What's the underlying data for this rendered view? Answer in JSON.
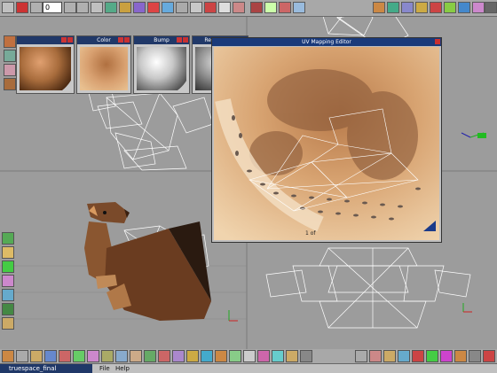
{
  "top_toolbar": {
    "frame_value": "0"
  },
  "material_panels": [
    {
      "title": "",
      "color": "#a86c3c"
    },
    {
      "title": "Color",
      "color": "#d8a070"
    },
    {
      "title": "Bump",
      "color": "#d8d8d8"
    },
    {
      "title": "Reflectance",
      "color": "#909090"
    }
  ],
  "uv_editor": {
    "title": "UV Mapping Editor",
    "status": "1 of"
  },
  "statusbar": {
    "filename": "truespace_final",
    "menu": [
      "File",
      "Help"
    ]
  },
  "colors": {
    "title_bar": "#203868",
    "texture": "#d8a070",
    "viewport": "#9c9c9c"
  }
}
